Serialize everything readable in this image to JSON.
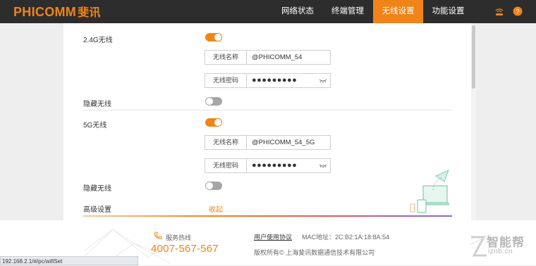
{
  "header": {
    "logo_text": "PHICOMM",
    "logo_cn": "斐讯",
    "nav": [
      {
        "label": "网络状态",
        "active": false
      },
      {
        "label": "终端管理",
        "active": false
      },
      {
        "label": "无线设置",
        "active": true
      },
      {
        "label": "功能设置",
        "active": false
      }
    ],
    "icons": [
      "wifi-router-icon",
      "help-icon"
    ],
    "help_glyph": "?"
  },
  "wireless": {
    "band_24": {
      "label": "2.4G无线",
      "enabled": true,
      "ssid_label": "无线名称",
      "ssid_value": "@PHICOMM_54",
      "password_label": "无线密码",
      "password_value": "●●●●●●●●●",
      "hide_label": "隐藏无线",
      "hidden": false
    },
    "band_5": {
      "label": "5G无线",
      "enabled": true,
      "ssid_label": "无线名称",
      "ssid_value": "@PHICOMM_54_5G",
      "password_label": "无线密码",
      "password_value": "●●●●●●●●●",
      "hide_label": "隐藏无线",
      "hidden": false
    },
    "advanced_label": "高级设置",
    "collapse_label": "收起"
  },
  "footer": {
    "hotline_label": "服务热线",
    "hotline_number": "4007-567-567",
    "user_agreement": "用户使用协议",
    "mac": "MAC地址：2C:B2:1A:18:8A:54",
    "copyright": "版权所有© 上海斐讯数据通信技术有限公司"
  },
  "status_bar": {
    "url": "192.168.2.1/#/pc/wifiSet"
  },
  "watermark": {
    "text": "智能帮",
    "url": "iznb.cn"
  },
  "colors": {
    "accent": "#f08418",
    "header_bg": "#2d2d2d",
    "toggle_off": "#a6a6a6"
  }
}
